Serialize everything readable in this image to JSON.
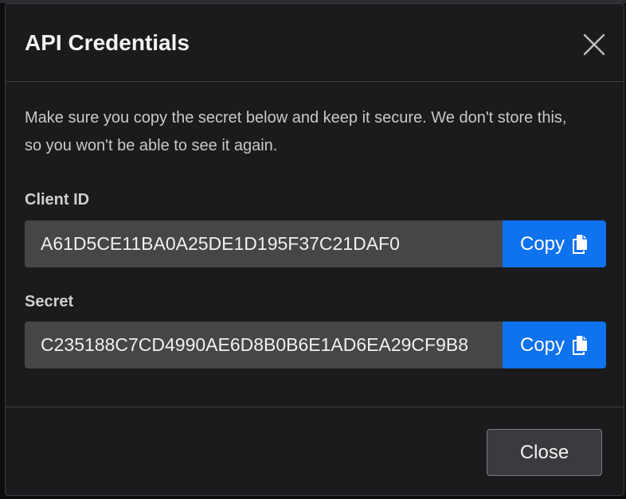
{
  "dialog": {
    "title": "API Credentials",
    "notice": "Make sure you copy the secret below and keep it secure. We don't store this, so you won't be able to see it again."
  },
  "client_id": {
    "label": "Client ID",
    "value": "A61D5CE11BA0A25DE1D195F37C21DAF0",
    "copy_label": "Copy"
  },
  "secret": {
    "label": "Secret",
    "value": "C235188C7CD4990AE6D8B0B6E1AD6EA29CF9B8",
    "copy_label": "Copy"
  },
  "footer": {
    "close_label": "Close"
  },
  "icons": {
    "close": "close-icon",
    "copy": "copy-icon"
  },
  "colors": {
    "accent": "#0f72ee",
    "dialog_bg": "#1b1b1d",
    "input_bg": "#454648"
  }
}
